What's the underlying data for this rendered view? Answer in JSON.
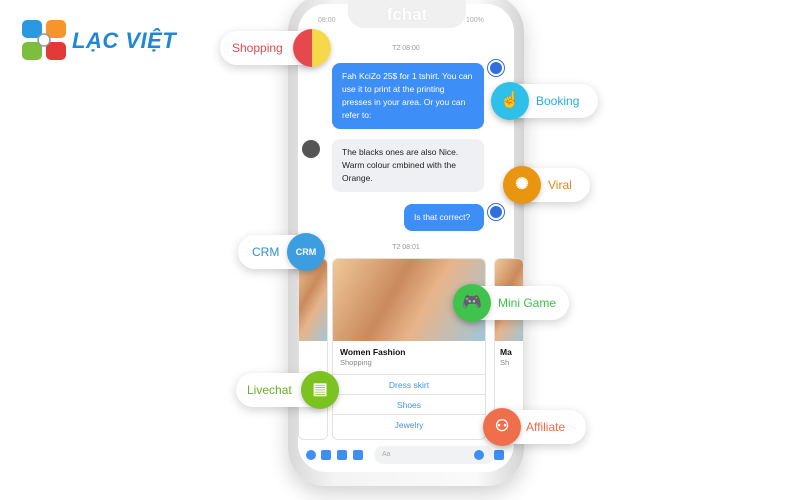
{
  "brand": {
    "name": "LẠC VIỆT",
    "colors": [
      "#2a9ae0",
      "#f5962a",
      "#7cbf3f",
      "#e23a36"
    ]
  },
  "phone": {
    "app_title": "fchat",
    "time": "08:00",
    "battery": "100%"
  },
  "chat": {
    "timestamp1": "T2 08:00",
    "msg1": "Fah KciZo 25$ for 1 tshirt. You can use it to print at the printing presses in your area. Or you can refer to:",
    "msg2": "The blacks ones are also Nice. Warm colour cmbined with the Orange.",
    "msg3": "Is that correct?",
    "timestamp2": "T2 08:01",
    "card": {
      "title": "Women Fashion",
      "subtitle": "Shopping",
      "buttons": [
        "Dress skirt",
        "Shoes",
        "Jewelry"
      ]
    },
    "next_card": {
      "title": "Ma",
      "subtitle": "Sh"
    },
    "input_placeholder": "Aa"
  },
  "features": [
    {
      "label": "Shopping",
      "icon": "shopping-bag-icon",
      "color": "#e5484d"
    },
    {
      "label": "Booking",
      "icon": "booking-hand-icon",
      "color": "#2aa7e0"
    },
    {
      "label": "Viral",
      "icon": "viral-network-icon",
      "color": "#e58a12"
    },
    {
      "label": "CRM",
      "icon": "crm-icon",
      "color": "#2a8fd8"
    },
    {
      "label": "Mini Game",
      "icon": "gamepad-icon",
      "color": "#3cbf4a"
    },
    {
      "label": "Livechat",
      "icon": "chat-bubbles-icon",
      "color": "#6aae1f"
    },
    {
      "label": "Affiliate",
      "icon": "affiliate-network-icon",
      "color": "#ee6b4a"
    }
  ]
}
